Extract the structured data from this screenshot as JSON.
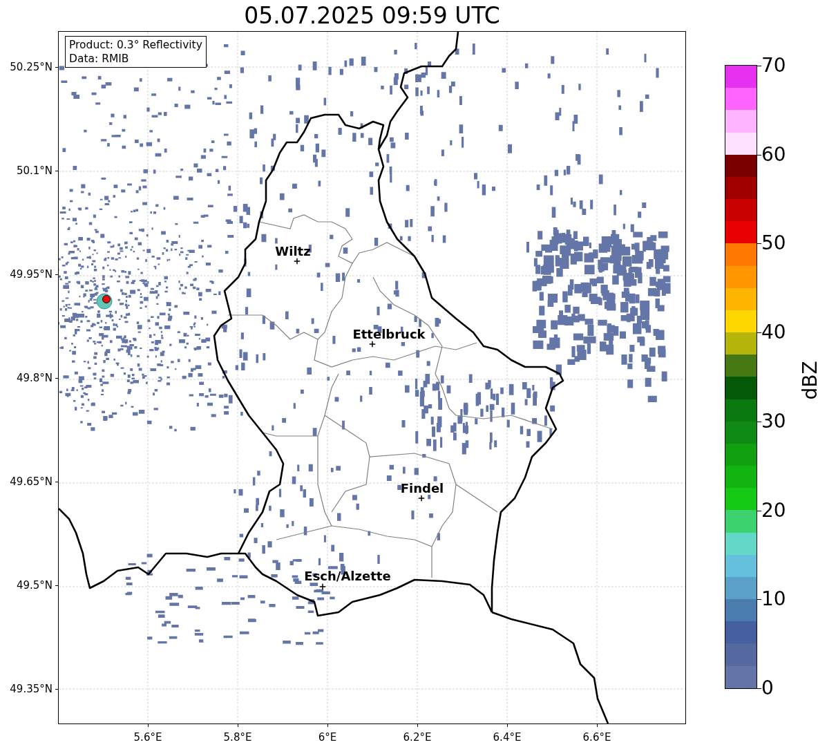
{
  "title": "05.07.2025 09:59 UTC",
  "info": [
    "Product: 0.3° Reflectivity",
    "Data: RMIB"
  ],
  "cities": [
    "Wiltz",
    "Ettelbruck",
    "Findel",
    "Esch/Alzette"
  ],
  "lat_ticks": [
    "50.25°N",
    "50.1°N",
    "49.95°N",
    "49.8°N",
    "49.65°N",
    "49.5°N",
    "49.35°N"
  ],
  "lon_ticks": [
    "5.6°E",
    "5.8°E",
    "6°E",
    "6.2°E",
    "6.4°E",
    "6.6°E"
  ],
  "colorbar": {
    "label": "dBZ",
    "ticks": [
      "70",
      "60",
      "50",
      "40",
      "30",
      "20",
      "10",
      "0"
    ],
    "segments": [
      {
        "color": "#e632f0"
      },
      {
        "color": "#ff64ff"
      },
      {
        "color": "#ffb4ff"
      },
      {
        "color": "#ffe0ff"
      },
      {
        "color": "#780000"
      },
      {
        "color": "#a00000"
      },
      {
        "color": "#c80000"
      },
      {
        "color": "#e60000"
      },
      {
        "color": "#ff7800"
      },
      {
        "color": "#ff9600"
      },
      {
        "color": "#ffb400"
      },
      {
        "color": "#ffd700"
      },
      {
        "color": "#b4b40a"
      },
      {
        "color": "#467814"
      },
      {
        "color": "#055a0a"
      },
      {
        "color": "#0a7a10"
      },
      {
        "color": "#0f8a14"
      },
      {
        "color": "#10a010"
      },
      {
        "color": "#12b412"
      },
      {
        "color": "#14c814"
      },
      {
        "color": "#3cd26e"
      },
      {
        "color": "#64d8c8"
      },
      {
        "color": "#64c0dc"
      },
      {
        "color": "#5aa0c8"
      },
      {
        "color": "#4a7cb0"
      },
      {
        "color": "#465fa0"
      },
      {
        "color": "#55689f"
      },
      {
        "color": "#6474a8"
      }
    ]
  }
}
